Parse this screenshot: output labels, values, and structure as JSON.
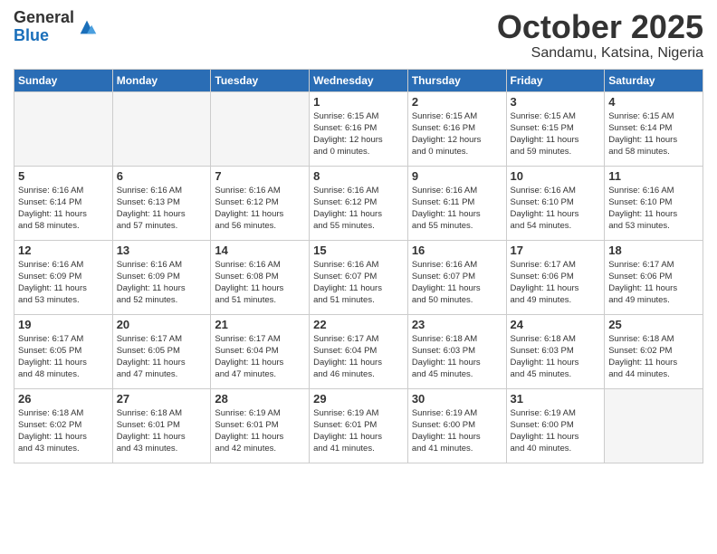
{
  "header": {
    "logo_line1": "General",
    "logo_line2": "Blue",
    "month": "October 2025",
    "location": "Sandamu, Katsina, Nigeria"
  },
  "weekdays": [
    "Sunday",
    "Monday",
    "Tuesday",
    "Wednesday",
    "Thursday",
    "Friday",
    "Saturday"
  ],
  "weeks": [
    [
      {
        "day": "",
        "info": ""
      },
      {
        "day": "",
        "info": ""
      },
      {
        "day": "",
        "info": ""
      },
      {
        "day": "1",
        "info": "Sunrise: 6:15 AM\nSunset: 6:16 PM\nDaylight: 12 hours\nand 0 minutes."
      },
      {
        "day": "2",
        "info": "Sunrise: 6:15 AM\nSunset: 6:16 PM\nDaylight: 12 hours\nand 0 minutes."
      },
      {
        "day": "3",
        "info": "Sunrise: 6:15 AM\nSunset: 6:15 PM\nDaylight: 11 hours\nand 59 minutes."
      },
      {
        "day": "4",
        "info": "Sunrise: 6:15 AM\nSunset: 6:14 PM\nDaylight: 11 hours\nand 58 minutes."
      }
    ],
    [
      {
        "day": "5",
        "info": "Sunrise: 6:16 AM\nSunset: 6:14 PM\nDaylight: 11 hours\nand 58 minutes."
      },
      {
        "day": "6",
        "info": "Sunrise: 6:16 AM\nSunset: 6:13 PM\nDaylight: 11 hours\nand 57 minutes."
      },
      {
        "day": "7",
        "info": "Sunrise: 6:16 AM\nSunset: 6:12 PM\nDaylight: 11 hours\nand 56 minutes."
      },
      {
        "day": "8",
        "info": "Sunrise: 6:16 AM\nSunset: 6:12 PM\nDaylight: 11 hours\nand 55 minutes."
      },
      {
        "day": "9",
        "info": "Sunrise: 6:16 AM\nSunset: 6:11 PM\nDaylight: 11 hours\nand 55 minutes."
      },
      {
        "day": "10",
        "info": "Sunrise: 6:16 AM\nSunset: 6:10 PM\nDaylight: 11 hours\nand 54 minutes."
      },
      {
        "day": "11",
        "info": "Sunrise: 6:16 AM\nSunset: 6:10 PM\nDaylight: 11 hours\nand 53 minutes."
      }
    ],
    [
      {
        "day": "12",
        "info": "Sunrise: 6:16 AM\nSunset: 6:09 PM\nDaylight: 11 hours\nand 53 minutes."
      },
      {
        "day": "13",
        "info": "Sunrise: 6:16 AM\nSunset: 6:09 PM\nDaylight: 11 hours\nand 52 minutes."
      },
      {
        "day": "14",
        "info": "Sunrise: 6:16 AM\nSunset: 6:08 PM\nDaylight: 11 hours\nand 51 minutes."
      },
      {
        "day": "15",
        "info": "Sunrise: 6:16 AM\nSunset: 6:07 PM\nDaylight: 11 hours\nand 51 minutes."
      },
      {
        "day": "16",
        "info": "Sunrise: 6:16 AM\nSunset: 6:07 PM\nDaylight: 11 hours\nand 50 minutes."
      },
      {
        "day": "17",
        "info": "Sunrise: 6:17 AM\nSunset: 6:06 PM\nDaylight: 11 hours\nand 49 minutes."
      },
      {
        "day": "18",
        "info": "Sunrise: 6:17 AM\nSunset: 6:06 PM\nDaylight: 11 hours\nand 49 minutes."
      }
    ],
    [
      {
        "day": "19",
        "info": "Sunrise: 6:17 AM\nSunset: 6:05 PM\nDaylight: 11 hours\nand 48 minutes."
      },
      {
        "day": "20",
        "info": "Sunrise: 6:17 AM\nSunset: 6:05 PM\nDaylight: 11 hours\nand 47 minutes."
      },
      {
        "day": "21",
        "info": "Sunrise: 6:17 AM\nSunset: 6:04 PM\nDaylight: 11 hours\nand 47 minutes."
      },
      {
        "day": "22",
        "info": "Sunrise: 6:17 AM\nSunset: 6:04 PM\nDaylight: 11 hours\nand 46 minutes."
      },
      {
        "day": "23",
        "info": "Sunrise: 6:18 AM\nSunset: 6:03 PM\nDaylight: 11 hours\nand 45 minutes."
      },
      {
        "day": "24",
        "info": "Sunrise: 6:18 AM\nSunset: 6:03 PM\nDaylight: 11 hours\nand 45 minutes."
      },
      {
        "day": "25",
        "info": "Sunrise: 6:18 AM\nSunset: 6:02 PM\nDaylight: 11 hours\nand 44 minutes."
      }
    ],
    [
      {
        "day": "26",
        "info": "Sunrise: 6:18 AM\nSunset: 6:02 PM\nDaylight: 11 hours\nand 43 minutes."
      },
      {
        "day": "27",
        "info": "Sunrise: 6:18 AM\nSunset: 6:01 PM\nDaylight: 11 hours\nand 43 minutes."
      },
      {
        "day": "28",
        "info": "Sunrise: 6:19 AM\nSunset: 6:01 PM\nDaylight: 11 hours\nand 42 minutes."
      },
      {
        "day": "29",
        "info": "Sunrise: 6:19 AM\nSunset: 6:01 PM\nDaylight: 11 hours\nand 41 minutes."
      },
      {
        "day": "30",
        "info": "Sunrise: 6:19 AM\nSunset: 6:00 PM\nDaylight: 11 hours\nand 41 minutes."
      },
      {
        "day": "31",
        "info": "Sunrise: 6:19 AM\nSunset: 6:00 PM\nDaylight: 11 hours\nand 40 minutes."
      },
      {
        "day": "",
        "info": ""
      }
    ]
  ]
}
